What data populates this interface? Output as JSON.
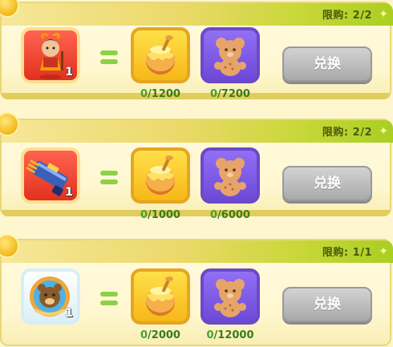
{
  "offers": [
    {
      "limit": "限购: 2/2",
      "reward": {
        "icon": "warrior-hero-icon",
        "qty": "1"
      },
      "costs": [
        {
          "icon": "honey-pot-icon",
          "have": "0",
          "need": "/1200"
        },
        {
          "icon": "bear-cookie-icon",
          "have": "0",
          "need": "/7200"
        }
      ],
      "button": "兑换"
    },
    {
      "limit": "限购: 2/2",
      "reward": {
        "icon": "gatling-weapon-icon",
        "qty": "1"
      },
      "costs": [
        {
          "icon": "honey-pot-icon",
          "have": "0",
          "need": "/1000"
        },
        {
          "icon": "bear-cookie-icon",
          "have": "0",
          "need": "/6000"
        }
      ],
      "button": "兑换"
    },
    {
      "limit": "限购: 1/1",
      "reward": {
        "icon": "bear-avatar-frame-icon",
        "qty": "1"
      },
      "costs": [
        {
          "icon": "honey-pot-icon",
          "have": "0",
          "need": "/2000"
        },
        {
          "icon": "bear-cookie-icon",
          "have": "0",
          "need": "/12000"
        }
      ],
      "button": "兑换"
    }
  ]
}
